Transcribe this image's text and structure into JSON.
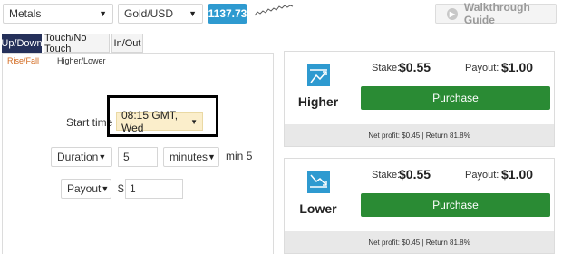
{
  "header": {
    "market": "Metals",
    "pair": "Gold/USD",
    "price": "1137.73",
    "walkthrough_label": "Walkthrough Guide"
  },
  "tabs": [
    {
      "label": "Up/Down",
      "active": true
    },
    {
      "label": "Touch/No Touch",
      "active": false
    },
    {
      "label": "In/Out",
      "active": false
    }
  ],
  "subtabs": [
    {
      "label": "Rise/Fall",
      "color": "#d2691e"
    },
    {
      "label": "Higher/Lower"
    }
  ],
  "form": {
    "start_label": "Start time",
    "start_value": "08:15 GMT, Wed",
    "duration_label": "Duration",
    "duration_value": "5",
    "duration_unit": "minutes",
    "min_label": "min",
    "min_value": "5",
    "payout_label": "Payout",
    "currency": "$",
    "amount": "1"
  },
  "contracts": {
    "higher": {
      "name": "Higher",
      "stake_label": "Stake:",
      "stake": "$0.55",
      "payout_label": "Payout:",
      "payout": "$1.00",
      "button": "Purchase",
      "footer": "Net profit: $0.45 | Return 81.8%"
    },
    "lower": {
      "name": "Lower",
      "stake_label": "Stake:",
      "stake": "$0.55",
      "payout_label": "Payout:",
      "payout": "$1.00",
      "button": "Purchase",
      "footer": "Net profit: $0.45 | Return 81.8%"
    }
  },
  "colors": {
    "accent_blue": "#2e9ad0",
    "tab_active": "#25305a",
    "purchase_green": "#2a8b34",
    "start_highlight": "#fbeecb"
  }
}
